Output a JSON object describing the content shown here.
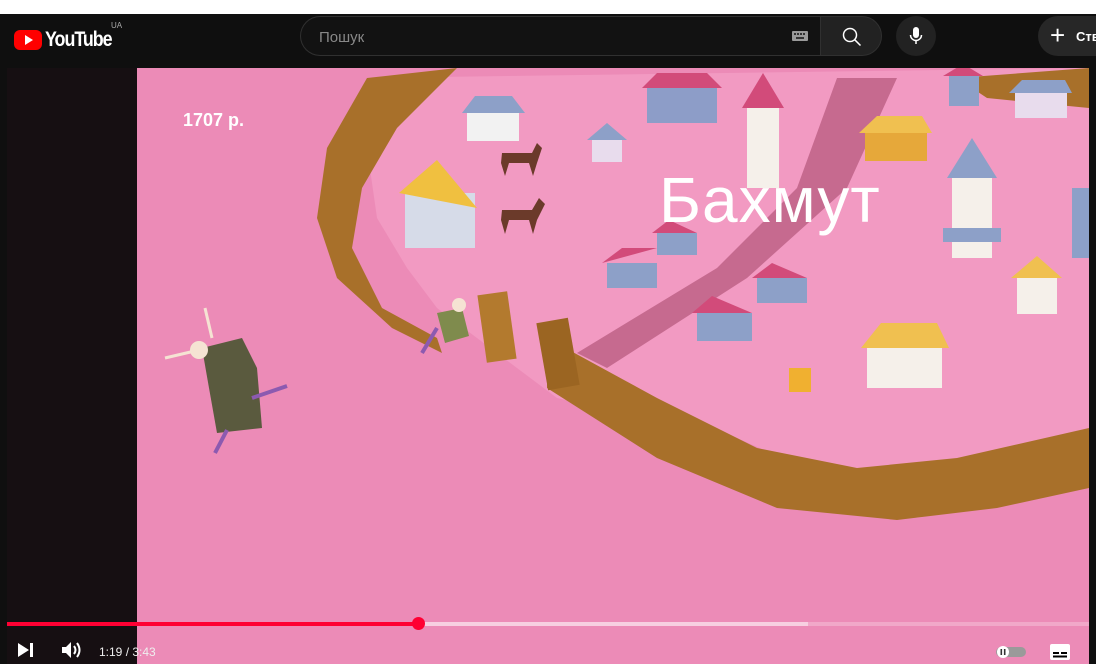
{
  "masthead": {
    "logo_text": "YouTube",
    "country_code": "UA",
    "search_placeholder": "Пошук",
    "create_label": "Ств"
  },
  "video": {
    "year_caption": "1707 р.",
    "city_caption": "Бахмут"
  },
  "player": {
    "current_time": "1:19",
    "duration": "3:43",
    "time_separator": " / ",
    "played_fraction": 0.38,
    "buffered_fraction": 0.74
  },
  "colors": {
    "brand_red": "#ff0000",
    "progress_red": "#ff0033",
    "video_pink": "#ec8bb7",
    "fence_brown": "#a8702a"
  }
}
